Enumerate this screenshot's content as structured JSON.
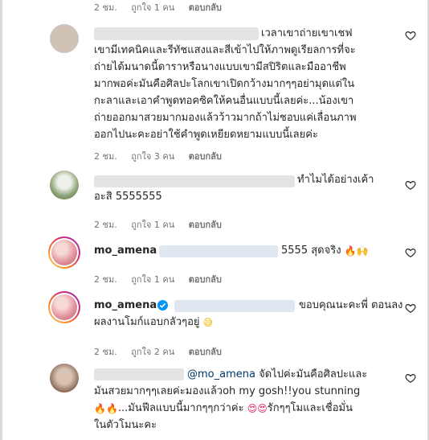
{
  "comments": [
    {
      "username": "",
      "text": "เวลาเขาถ่ายเขาเชฟ เขามีเทคนิคและรีทัชแสงและสีเข้าไปให้ภาพดูเรียลการที่จะถ่ายได้มนาดนี้ดาราหรือนางแบบเขามีสปิริตและมืออาชีพมากพอค่ะมันคือศิลปะโลกเขาเปิดกว้างมากๆๆอย่ามุดแต่ในกะลาและเอาคำพูดทอคซิคให้คนอื่นแบบนี้เลยค่ะ...น้องเขาถ่ายออกมาสวยมากมองแล้วว้าวมากถ้าไม่ชอบแค่เลื่อนภาพออกไปนะคะอย่าใช้คำพูดเหยียดหยามแบบนี้เลยค่ะ",
      "lines": [
        "เวลาเขาถ่ายเขาเชฟ",
        "เขามีเทคนิคและรีทัชแสงและสีเข้าไปให้ภาพดูเรียลการที่จะ",
        "ถ่ายได้มนาดนี้ดาราหรือนางแบบเขามีสปิริตและมืออาชีพ",
        "มากพอค่ะมันคือศิลปะโลกเขาเปิดกว้างมากๆๆอย่ามุดแต่ใน",
        "กะลาและเอาคำพูดทอคซิคให้คนอื่นแบบนี้เลยค่ะ...น้องเขา",
        "ถ่ายออกมาสวยมากมองแล้วว้าวมากถ้าไม่ชอบแค่เลื่อนภาพ",
        "ออกไปนะคะอย่าใช้คำพูดเหยียดหยามแบบนี้เลยค่ะ"
      ],
      "time": "2 ชม.",
      "likes": "ถูกใจ 3 คน",
      "reply": "ตอบกลับ"
    },
    {
      "username": "",
      "line1": "ทำไมได้อย่างเค้า",
      "line2": "อะสิ 5555555",
      "time": "2 ชม.",
      "likes": "ถูกใจ 1 คน",
      "reply": "ตอบกลับ"
    },
    {
      "username": "mo_amena",
      "text_after_blur": "5555 สุดจริง",
      "time": "2 ชม.",
      "likes": "ถูกใจ 1 คน",
      "reply": "ตอบกลับ"
    },
    {
      "username": "mo_amena",
      "verified": true,
      "line1": "ขอบคุณนะคะพี่ ตอนลง",
      "line2": "ผลงานโมก์แอบกลัวๆอยู่",
      "time": "2 ชม.",
      "likes": "ถูกใจ 2 คน",
      "reply": "ตอบกลับ"
    },
    {
      "username": "",
      "mention": "@mo_amena",
      "line1_rest": "จัดไปค่ะมันคือศิลปะและ",
      "line2": "มันสวยมากๆๆเลยค่ะมองแล้วoh my gosh!!you stunning",
      "line3": "...มันฟีลแบบนี้มากๆๆกว่าค่ะ",
      "line3b": "รักๆๆโมและเชื่อมั่น",
      "line4": "ในตัวโมนะคะ"
    }
  ],
  "top_meta": {
    "time": "2 ชม.",
    "likes": "ถูกใจ 1 คน",
    "reply": "ตอบกลับ"
  },
  "icons": {
    "like": "heart-outline-icon",
    "verified": "verified-badge-icon",
    "fire": "fire-emoji",
    "praying": "praying-hands-emoji",
    "sweat_smile": "sweat-smile-emoji",
    "heart_eyes": "heart-eyes-emoji"
  },
  "colors": {
    "text": "#262626",
    "secondary": "#737373",
    "mention": "#00376b",
    "verified": "#0095f6",
    "story_ring": "#d6249f"
  }
}
